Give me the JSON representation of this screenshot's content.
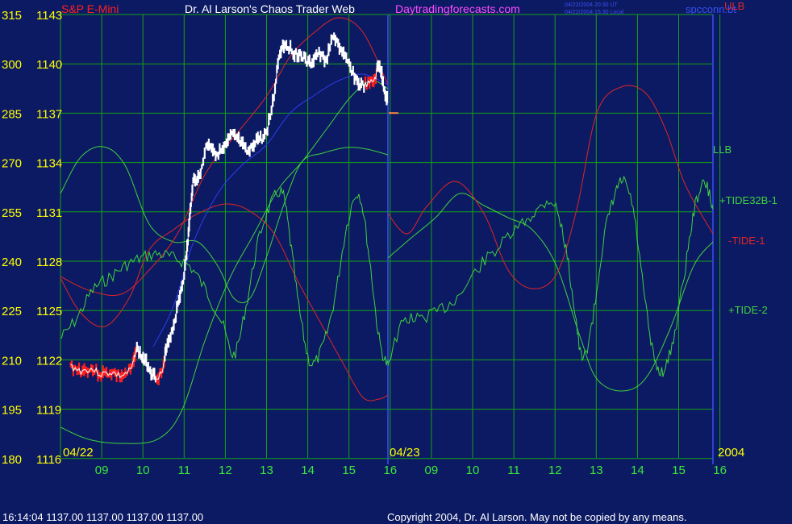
{
  "header": {
    "symbol": "S&P E-Mini",
    "title": "Dr. Al Larson's Chaos Trader Web",
    "website": "Daytradingforecasts.com",
    "stamp_ut": "04/22/2004 20:30 UT",
    "stamp_local": "04/22/2004 15:30 Local",
    "chart_file": "spcconn.bt"
  },
  "footer": {
    "quote": "16:14:04   1137.00 1137.00 1137.00 1137.00",
    "copyright": "Copyright 2004, Dr. Al Larson. May not be copied by any means."
  },
  "colors": {
    "background": "#0c1a63",
    "grid": "#14a214",
    "price_white": "#ffffff",
    "price_red": "#ff2020",
    "tide_green": "#3fd23f",
    "tide_red": "#e02525",
    "ma_blue": "#2d3df0",
    "yellow": "#ffff00",
    "magenta": "#ff4bff",
    "time_labels": "#39e839"
  },
  "chart_data": {
    "type": "line",
    "left_axis": [
      "315",
      "300",
      "285",
      "270",
      "255",
      "240",
      "225",
      "210",
      "195",
      "180"
    ],
    "right_axis": [
      "1143",
      "1140",
      "1137",
      "1134",
      "1131",
      "1128",
      "1125",
      "1122",
      "1119",
      "1116"
    ],
    "ylim": [
      1116,
      1143
    ],
    "x_ticks": [
      "09",
      "10",
      "11",
      "12",
      "13",
      "14",
      "15",
      "16",
      "09",
      "10",
      "11",
      "12",
      "13",
      "14",
      "15",
      "16"
    ],
    "date_labels": [
      "04/22",
      "04/23"
    ],
    "year_label": "2004",
    "series_labels": [
      "ULB",
      "LLB",
      "+TIDE32B-1",
      "-TIDE-1",
      "+TIDE-2"
    ],
    "price": [
      [
        8.25,
        1121.6
      ],
      [
        8.5,
        1121.3
      ],
      [
        8.75,
        1121.4
      ],
      [
        9.0,
        1121.1
      ],
      [
        9.25,
        1121.2
      ],
      [
        9.5,
        1121.0
      ],
      [
        9.75,
        1121.5
      ],
      [
        9.85,
        1122.6
      ],
      [
        10.0,
        1122.1
      ],
      [
        10.15,
        1121.6
      ],
      [
        10.3,
        1121.0
      ],
      [
        10.5,
        1121.3
      ],
      [
        10.6,
        1122.8
      ],
      [
        10.75,
        1123.9
      ],
      [
        10.9,
        1125.6
      ],
      [
        11.05,
        1127.6
      ],
      [
        11.15,
        1130.1
      ],
      [
        11.25,
        1132.8
      ],
      [
        11.4,
        1133.1
      ],
      [
        11.6,
        1135.1
      ],
      [
        11.8,
        1134.6
      ],
      [
        12.0,
        1134.8
      ],
      [
        12.2,
        1135.6
      ],
      [
        12.4,
        1135.2
      ],
      [
        12.6,
        1134.6
      ],
      [
        12.8,
        1135.4
      ],
      [
        13.0,
        1135.6
      ],
      [
        13.2,
        1137.6
      ],
      [
        13.35,
        1140.4
      ],
      [
        13.5,
        1141.2
      ],
      [
        13.7,
        1140.7
      ],
      [
        13.9,
        1140.5
      ],
      [
        14.1,
        1140.0
      ],
      [
        14.3,
        1140.6
      ],
      [
        14.5,
        1140.3
      ],
      [
        14.7,
        1141.6
      ],
      [
        14.9,
        1140.6
      ],
      [
        15.1,
        1139.8
      ],
      [
        15.3,
        1138.8
      ],
      [
        15.5,
        1138.7
      ],
      [
        15.7,
        1139.1
      ],
      [
        15.8,
        1140.0
      ],
      [
        15.9,
        1138.8
      ],
      [
        16.0,
        1137.8
      ]
    ],
    "price_red_segments": [
      [
        8.1,
        9.85
      ],
      [
        10.35,
        10.55
      ],
      [
        15.45,
        15.75
      ]
    ],
    "last_price": 1137.0
  }
}
